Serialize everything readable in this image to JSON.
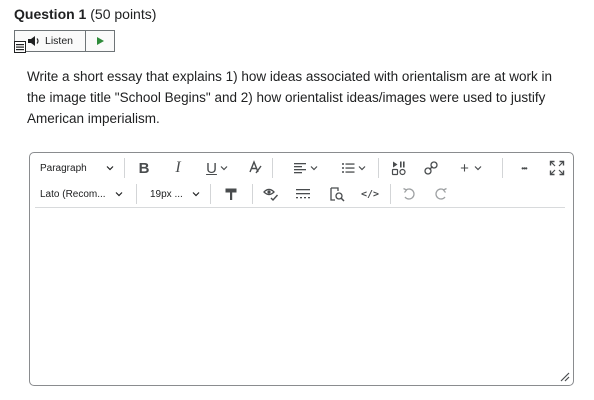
{
  "question": {
    "number_label": "Question 1",
    "points_label": "(50 points)"
  },
  "listen": {
    "label": "Listen"
  },
  "prompt_text": "Write a short essay that explains 1) how ideas associated with orientalism are at work in the image title \"School Begins\" and 2) how orientalist ideas/images were used to justify American imperialism.",
  "toolbar": {
    "format_select": "Paragraph",
    "font_select": "Lato (Recom...",
    "size_select": "19px ...",
    "bold_label": "B",
    "italic_label": "I",
    "underline_label": "U",
    "insert_label": "+",
    "more_label": "•••",
    "source_label": "</>"
  },
  "colors": {
    "text": "#202122",
    "icon": "#494c4e",
    "border": "#8a8c8f",
    "play_green": "#2e8b3a",
    "disabled": "#9ea1a3"
  }
}
